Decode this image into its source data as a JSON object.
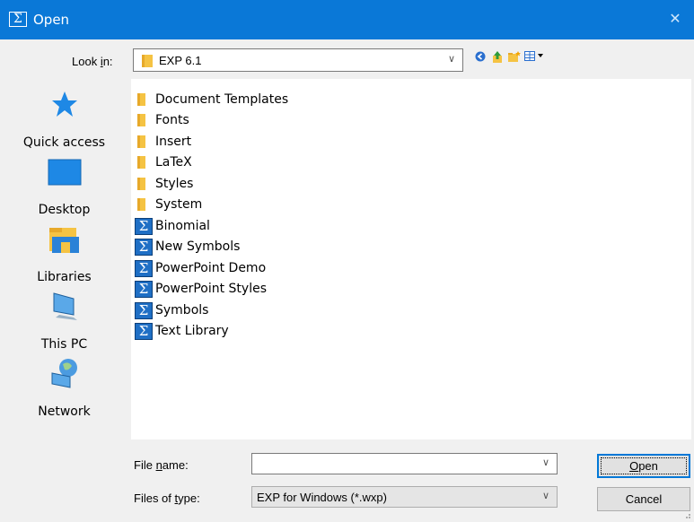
{
  "window": {
    "title": "Open",
    "app_icon": "sigma-icon",
    "close_glyph": "✕"
  },
  "lookin": {
    "label_pre": "Look ",
    "label_accel": "i",
    "label_post": "n:",
    "value": "EXP 6.1",
    "arrow": "∨"
  },
  "toolbar": [
    "back-icon",
    "up-folder-icon",
    "new-folder-icon",
    "view-menu-icon"
  ],
  "places": [
    {
      "label": "Quick access",
      "icon": "quick-access-star-icon"
    },
    {
      "label": "Desktop",
      "icon": "desktop-icon"
    },
    {
      "label": "Libraries",
      "icon": "libraries-icon"
    },
    {
      "label": "This PC",
      "icon": "this-pc-icon"
    },
    {
      "label": "Network",
      "icon": "network-icon"
    }
  ],
  "files": [
    {
      "name": "Document Templates",
      "type": "folder"
    },
    {
      "name": "Fonts",
      "type": "folder"
    },
    {
      "name": "Insert",
      "type": "folder"
    },
    {
      "name": "LaTeX",
      "type": "folder"
    },
    {
      "name": "Styles",
      "type": "folder"
    },
    {
      "name": "System",
      "type": "folder"
    },
    {
      "name": "Binomial",
      "type": "exp"
    },
    {
      "name": "New Symbols",
      "type": "exp"
    },
    {
      "name": "PowerPoint Demo",
      "type": "exp"
    },
    {
      "name": "PowerPoint Styles",
      "type": "exp"
    },
    {
      "name": "Symbols",
      "type": "exp"
    },
    {
      "name": "Text Library",
      "type": "exp"
    }
  ],
  "filename": {
    "label_pre": "File ",
    "label_accel": "n",
    "label_post": "ame:",
    "value": "",
    "arrow": "∨"
  },
  "filetype": {
    "label_pre": "Files of ",
    "label_accel": "t",
    "label_post": "ype:",
    "value": "EXP for Windows (*.wxp)",
    "arrow": "∨"
  },
  "buttons": {
    "open_accel": "O",
    "open_rest": "pen",
    "cancel": "Cancel"
  },
  "colors": {
    "titlebar": "#0a78d7",
    "folder": "#f5c343",
    "exp_icon": "#1f6fc5"
  }
}
